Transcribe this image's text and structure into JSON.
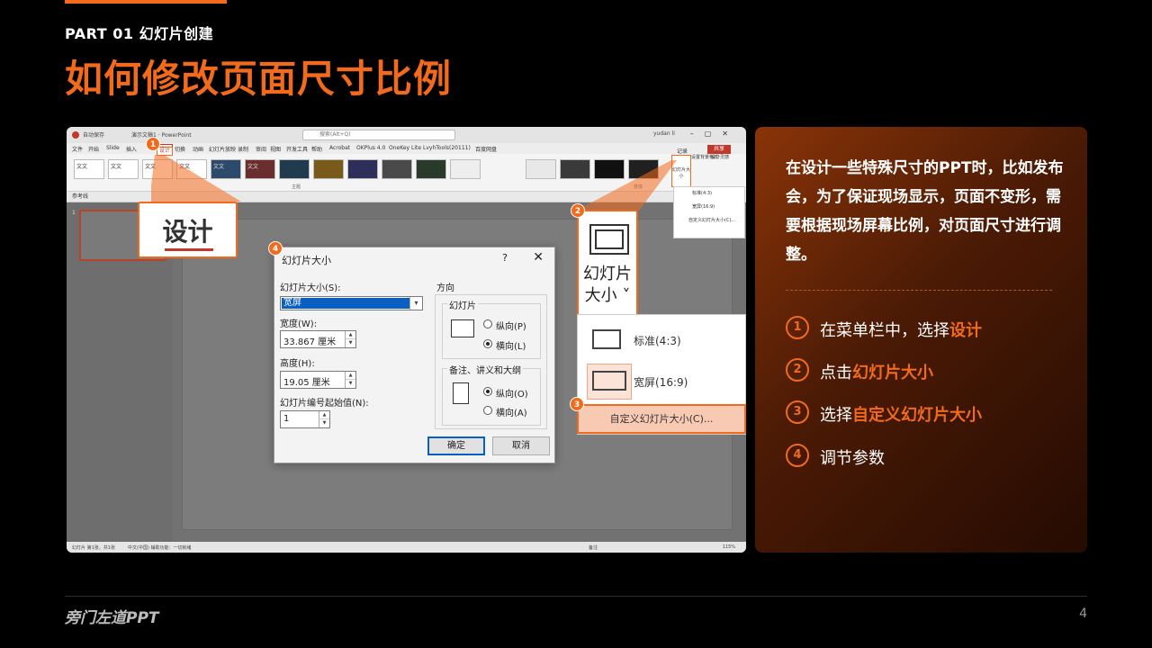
{
  "header": {
    "part_label": "PART 01  幻灯片创建",
    "title": "如何修改页面尺寸比例"
  },
  "colors": {
    "accent": "#f26a1b",
    "background": "#000000",
    "panel_gradient_start": "#8a3408",
    "panel_gradient_end": "#250b02"
  },
  "screenshot": {
    "app_title": "演示文稿1 · PowerPoint",
    "autosave_label": "自动保存",
    "search_placeholder": "搜索(Alt+Q)",
    "user_name": "yudan li",
    "menu": [
      "文件",
      "开始",
      "Slide",
      "插入",
      "设计",
      "切换",
      "动画",
      "幻灯片放映",
      "录制",
      "审阅",
      "视图",
      "开发工具",
      "帮助",
      "Acrobat",
      "OKPlus 4.0",
      "OneKey Lite",
      "LvyhTools(20111)",
      "百度网盘"
    ],
    "active_menu": "设计",
    "theme_label": "文文",
    "ribbon_group_theme": "主题",
    "ribbon_group_variant": "变体",
    "qat_label": "参考线",
    "slide_number": "1",
    "status_left": "幻灯片 第1张，共1张",
    "status_lang": "中文(中国)",
    "status_access": "辅助功能：一切就绪",
    "status_notes": "备注",
    "status_zoom": "115%",
    "right_buttons": [
      "记录",
      "共享"
    ],
    "mini_size_btn": "幻灯片大小",
    "mini_extra": [
      "设置背景格式",
      "设计灵感"
    ],
    "mini_menu": [
      "标准(4:3)",
      "宽屏(16:9)",
      "自定义幻灯片大小(C)..."
    ]
  },
  "callouts": {
    "design_label": "设计",
    "size_button_label": "幻灯片大小",
    "size_options": [
      {
        "label": "标准(4:3)",
        "selected": false
      },
      {
        "label": "宽屏(16:9)",
        "selected": true
      }
    ],
    "custom_size_label": "自定义幻灯片大小(C)...",
    "badges": [
      "1",
      "2",
      "3",
      "4"
    ]
  },
  "dialog": {
    "title": "幻灯片大小",
    "help": "?",
    "close": "✕",
    "size_label": "幻灯片大小(S):",
    "size_value": "宽屏",
    "width_label": "宽度(W):",
    "width_value": "33.867 厘米",
    "height_label": "高度(H):",
    "height_value": "19.05 厘米",
    "start_label": "幻灯片编号起始值(N):",
    "start_value": "1",
    "orientation_label": "方向",
    "slides_group": "幻灯片",
    "portrait_label": "纵向(P)",
    "landscape_label": "横向(L)",
    "slides_orientation": "landscape",
    "notes_group": "备注、讲义和大纲",
    "notes_portrait_label": "纵向(O)",
    "notes_landscape_label": "横向(A)",
    "notes_orientation": "portrait",
    "ok": "确定",
    "cancel": "取消"
  },
  "panel": {
    "intro": "在设计一些特殊尺寸的PPT时，比如发布会，为了保证现场显示，页面不变形，需要根据现场屏幕比例，对页面尺寸进行调整。",
    "steps": [
      {
        "num": "1",
        "prefix": "在菜单栏中，选择",
        "highlight": "设计"
      },
      {
        "num": "2",
        "prefix": "点击",
        "highlight": "幻灯片大小"
      },
      {
        "num": "3",
        "prefix": "选择",
        "highlight": "自定义幻灯片大小"
      },
      {
        "num": "4",
        "prefix": "调节参数",
        "highlight": ""
      }
    ]
  },
  "footer": {
    "brand": "旁门左道PPT",
    "page_number": "4"
  }
}
